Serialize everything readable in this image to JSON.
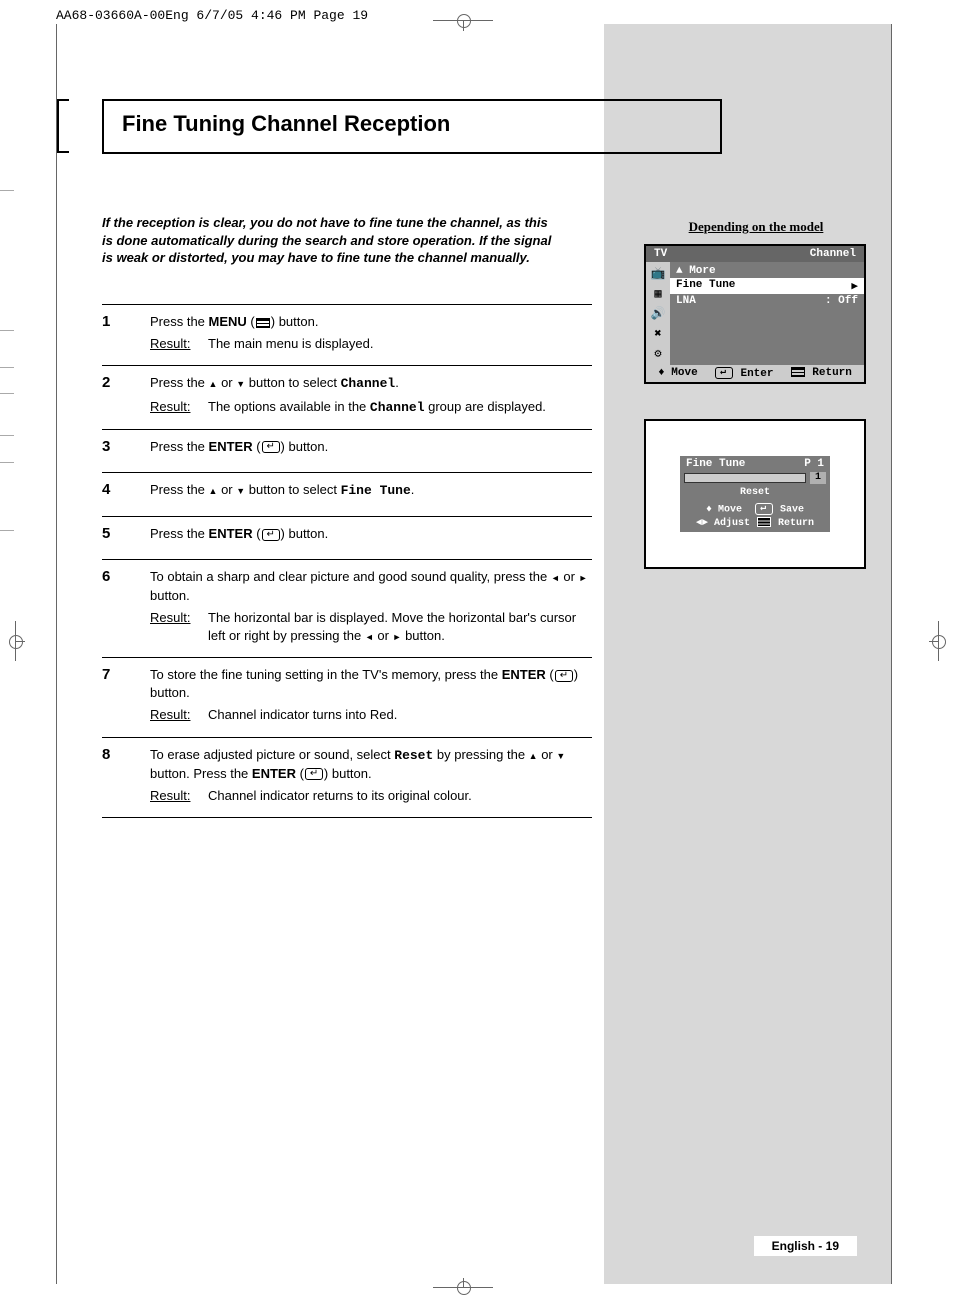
{
  "header_slug": "AA68-03660A-00Eng  6/7/05  4:46 PM  Page 19",
  "title": "Fine Tuning Channel Reception",
  "intro": "If the reception is clear, you do not have to fine tune the channel, as this is done automatically during the search and store operation. If the signal is weak or distorted, you may have to fine tune the channel manually.",
  "result_label": "Result:",
  "steps": [
    {
      "num": "1",
      "line1_a": "Press the ",
      "line1_b": "MENU",
      "line1_c": " (",
      "line1_d": ") button.",
      "result": "The main menu is displayed."
    },
    {
      "num": "2",
      "line1_a": "Press the ",
      "line1_b": " or ",
      "line1_c": " button to select ",
      "line1_d": "Channel",
      "result": "The options available in the ",
      "result_b": "Channel",
      "result_c": " group are displayed."
    },
    {
      "num": "3",
      "line1_a": "Press the ",
      "line1_b": "ENTER",
      "line1_c": " (",
      "line1_d": ") button."
    },
    {
      "num": "4",
      "line1_a": "Press the ",
      "line1_b": " or ",
      "line1_c": " button to select ",
      "line1_d": "Fine Tune"
    },
    {
      "num": "5",
      "line1_a": "Press the ",
      "line1_b": "ENTER",
      "line1_c": " (",
      "line1_d": ") button."
    },
    {
      "num": "6",
      "line1_a": "To obtain a sharp and clear picture and good sound quality, press the ",
      "line1_b": " or ",
      "line1_c": " button.",
      "result": "The horizontal bar is displayed. Move the horizontal bar's cursor left or right by pressing the ",
      "result_b": " or ",
      "result_c": " button."
    },
    {
      "num": "7",
      "line1_a": "To store the fine tuning setting in the TV's memory, press the ",
      "line1_b": "ENTER",
      "line1_c": " (",
      "line1_d": ") button.",
      "result": "Channel indicator turns into Red."
    },
    {
      "num": "8",
      "line1_a": "To erase adjusted picture or sound, select ",
      "line1_b": "Reset",
      "line1_c": "  by pressing the ",
      "line1_d": " or ",
      "line1_e": " button. Press the ",
      "line1_f": "ENTER",
      "line1_g": " (",
      "line1_h": ") button.",
      "result": "Channel indicator returns to its original colour."
    }
  ],
  "screenshots_label": "Depending on the model",
  "osd1": {
    "header_left": "TV",
    "header_right": "Channel",
    "rows": [
      {
        "left": "▲ More",
        "right": ""
      },
      {
        "left": "Fine Tune",
        "right": "▶",
        "hl": true
      },
      {
        "left": "LNA",
        "right": ": Off"
      }
    ],
    "footer": {
      "move": "Move",
      "enter": "Enter",
      "return": "Return"
    }
  },
  "osd2": {
    "title_left": "Fine Tune",
    "title_right": "P 1",
    "badge": "1",
    "reset": "Reset",
    "footer1_a": "Move",
    "footer1_b": "Save",
    "footer2_a": "Adjust",
    "footer2_b": "Return"
  },
  "page_num": "English - 19"
}
